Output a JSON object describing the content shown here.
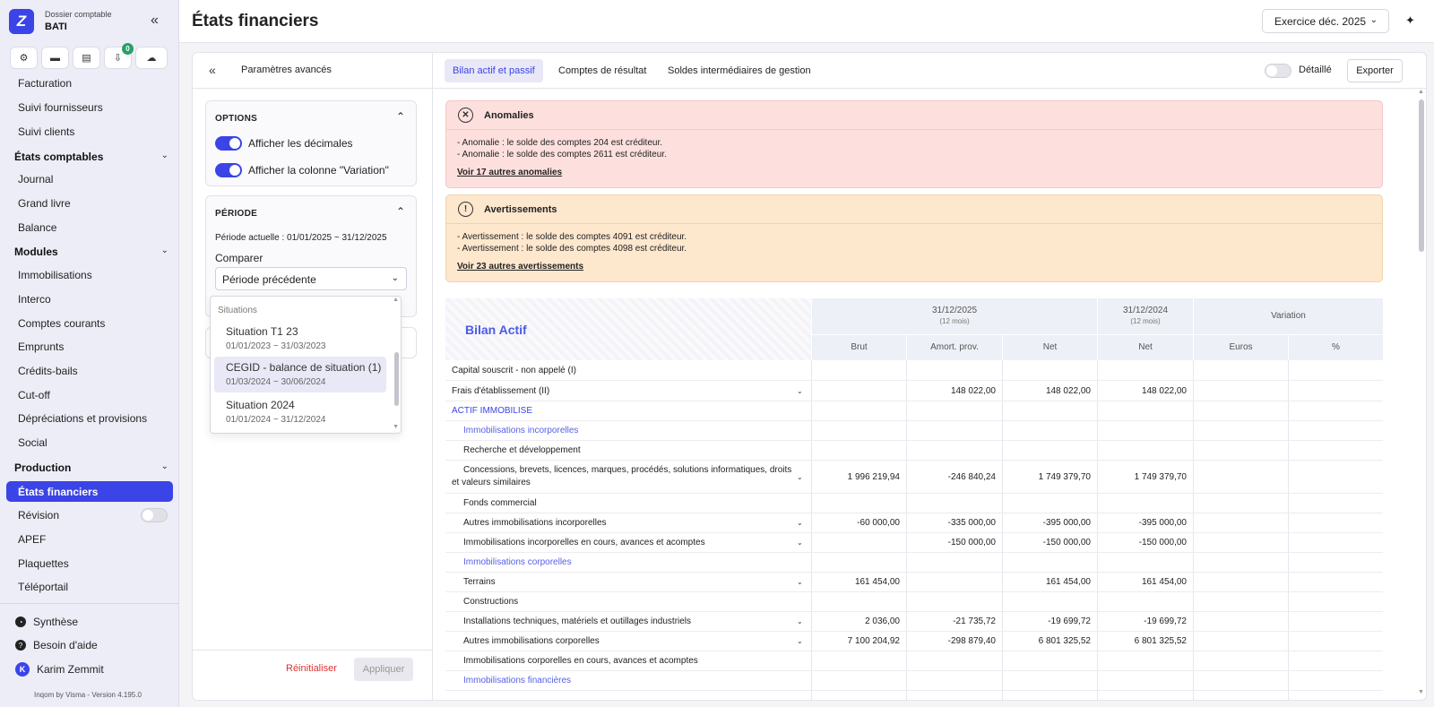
{
  "sidebar": {
    "brand_letter": "Z",
    "dossier_label": "Dossier comptable",
    "dossier_name": "BATI",
    "badge_count": "0",
    "items_top": [
      {
        "label": "Facturation"
      },
      {
        "label": "Suivi fournisseurs"
      },
      {
        "label": "Suivi clients"
      }
    ],
    "section_etats": "États comptables",
    "items_etats": [
      {
        "label": "Journal"
      },
      {
        "label": "Grand livre"
      },
      {
        "label": "Balance"
      }
    ],
    "section_modules": "Modules",
    "items_modules": [
      {
        "label": "Immobilisations"
      },
      {
        "label": "Interco"
      },
      {
        "label": "Comptes courants"
      },
      {
        "label": "Emprunts"
      },
      {
        "label": "Crédits-bails"
      },
      {
        "label": "Cut-off"
      },
      {
        "label": "Dépréciations et provisions"
      },
      {
        "label": "Social"
      }
    ],
    "section_production": "Production",
    "active_item": "États financiers",
    "items_production": [
      {
        "label": "Révision"
      },
      {
        "label": "APEF"
      },
      {
        "label": "Plaquettes"
      },
      {
        "label": "Téléportail"
      }
    ],
    "footer": {
      "synthese": "Synthèse",
      "aide": "Besoin d'aide",
      "user": "Karim Zemmit",
      "user_initial": "K",
      "version": "Inqom by Visma - Version 4.195.0"
    }
  },
  "header": {
    "title": "États financiers",
    "exercise": "Exercice déc. 2025"
  },
  "left_panel": {
    "title": "Paramètres avancés",
    "options_title": "OPTIONS",
    "opt_decimals": "Afficher les décimales",
    "opt_variation": "Afficher la colonne \"Variation\"",
    "periode_title": "PÉRIODE",
    "periode_actuelle": "Période actuelle : 01/01/2025 ~ 31/12/2025",
    "comparer_label": "Comparer",
    "comparer_value": "Période précédente",
    "dropdown": {
      "group": "Situations",
      "options": [
        {
          "title": "Situation T1 23",
          "dates": "01/01/2023 ~ 31/03/2023"
        },
        {
          "title": "CEGID - balance de situation (1)",
          "dates": "01/03/2024 ~ 30/06/2024"
        },
        {
          "title": "Situation 2024",
          "dates": "01/01/2024 ~ 31/12/2024"
        }
      ]
    },
    "reset": "Réinitialiser",
    "apply": "Appliquer"
  },
  "tabs": [
    {
      "label": "Bilan actif et passif"
    },
    {
      "label": "Comptes de résultat"
    },
    {
      "label": "Soldes intermédiaires de gestion"
    }
  ],
  "detail_label": "Détaillé",
  "export_label": "Exporter",
  "alerts": {
    "anomalies": {
      "title": "Anomalies",
      "lines": [
        "- Anomalie : le solde des comptes 204 est créditeur.",
        "- Anomalie : le solde des comptes 2611 est créditeur."
      ],
      "link": "Voir 17 autres anomalies"
    },
    "avertissements": {
      "title": "Avertissements",
      "lines": [
        "- Avertissement : le solde des comptes 4091 est créditeur.",
        "- Avertissement : le solde des comptes 4098 est créditeur."
      ],
      "link": "Voir 23 autres avertissements"
    }
  },
  "table": {
    "title": "Bilan Actif",
    "period1": "31/12/2025",
    "period1_sub": "(12 mois)",
    "period2": "31/12/2024",
    "period2_sub": "(12 mois)",
    "variation": "Variation",
    "cols": [
      "Brut",
      "Amort. prov.",
      "Net",
      "Net",
      "Euros",
      "%"
    ],
    "rows": [
      {
        "label": "Capital souscrit - non appelé (I)",
        "type": "row",
        "chev": false,
        "v": [
          "",
          "",
          "",
          "",
          "",
          ""
        ]
      },
      {
        "label": "Frais d'établissement (II)",
        "type": "row",
        "chev": true,
        "v": [
          "",
          "148 022,00",
          "148 022,00",
          "148 022,00",
          "",
          ""
        ]
      },
      {
        "label": "ACTIF IMMOBILISE",
        "type": "sec",
        "chev": false,
        "v": [
          "",
          "",
          "",
          "",
          "",
          ""
        ]
      },
      {
        "label": "Immobilisations incorporelles",
        "type": "sec2",
        "chev": false,
        "v": [
          "",
          "",
          "",
          "",
          "",
          ""
        ]
      },
      {
        "label": "Recherche et développement",
        "type": "sub",
        "chev": false,
        "v": [
          "",
          "",
          "",
          "",
          "",
          ""
        ]
      },
      {
        "label": "Concessions, brevets, licences, marques, procédés, solutions informatiques, droits et valeurs similaires",
        "type": "sub",
        "chev": true,
        "v": [
          "1 996 219,94",
          "-246 840,24",
          "1 749 379,70",
          "1 749 379,70",
          "",
          ""
        ]
      },
      {
        "label": "Fonds commercial",
        "type": "sub",
        "chev": false,
        "v": [
          "",
          "",
          "",
          "",
          "",
          ""
        ]
      },
      {
        "label": "Autres immobilisations incorporelles",
        "type": "sub",
        "chev": true,
        "v": [
          "-60 000,00",
          "-335 000,00",
          "-395 000,00",
          "-395 000,00",
          "",
          ""
        ]
      },
      {
        "label": "Immobilisations incorporelles en cours, avances et acomptes",
        "type": "sub",
        "chev": true,
        "v": [
          "",
          "-150 000,00",
          "-150 000,00",
          "-150 000,00",
          "",
          ""
        ]
      },
      {
        "label": "Immobilisations corporelles",
        "type": "sec2",
        "chev": false,
        "v": [
          "",
          "",
          "",
          "",
          "",
          ""
        ]
      },
      {
        "label": "Terrains",
        "type": "sub",
        "chev": true,
        "v": [
          "161 454,00",
          "",
          "161 454,00",
          "161 454,00",
          "",
          ""
        ]
      },
      {
        "label": "Constructions",
        "type": "sub",
        "chev": false,
        "v": [
          "",
          "",
          "",
          "",
          "",
          ""
        ]
      },
      {
        "label": "Installations techniques, matériels et outillages industriels",
        "type": "sub",
        "chev": true,
        "v": [
          "2 036,00",
          "-21 735,72",
          "-19 699,72",
          "-19 699,72",
          "",
          ""
        ]
      },
      {
        "label": "Autres immobilisations corporelles",
        "type": "sub",
        "chev": true,
        "v": [
          "7 100 204,92",
          "-298 879,40",
          "6 801 325,52",
          "6 801 325,52",
          "",
          ""
        ]
      },
      {
        "label": "Immobilisations corporelles en cours, avances et acomptes",
        "type": "sub",
        "chev": false,
        "v": [
          "",
          "",
          "",
          "",
          "",
          ""
        ]
      },
      {
        "label": "Immobilisations financières",
        "type": "sec2",
        "chev": false,
        "v": [
          "",
          "",
          "",
          "",
          "",
          ""
        ]
      }
    ]
  }
}
